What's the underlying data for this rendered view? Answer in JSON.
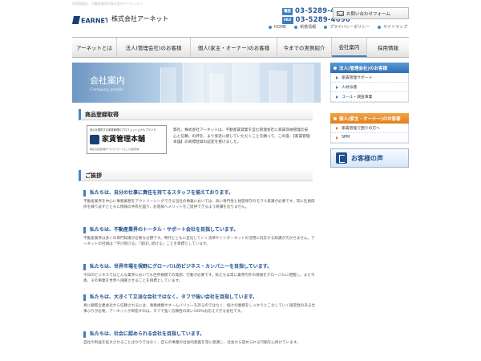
{
  "header": {
    "tagline": "家賃管理は、不動産業界の株式会社アーネットへ",
    "logo_text": "EARNET",
    "company_name": "株式会社アーネット",
    "phone_badge": "電話",
    "phone": "03-5289-4681",
    "fax_badge": "FAX",
    "fax": "03-5289-4690",
    "inquiry_label": "お問い合わせフォーム",
    "utility_nav": [
      "HOME",
      "新着情報",
      "プライバシーポリシー",
      "サイトマップ"
    ]
  },
  "global_nav": {
    "tabs": [
      {
        "label": "アーネットとは"
      },
      {
        "label": "法人(管理会社)のお客様"
      },
      {
        "label": "個人(家主・オーナー)のお客様"
      },
      {
        "label": "今までの実例紹介"
      },
      {
        "label": "会社案内"
      },
      {
        "label": "採用情報"
      }
    ],
    "active_index": 4
  },
  "hero": {
    "title": "会社案内",
    "subtitle": "Company profile"
  },
  "trademark_section": {
    "heading": "商品登録取得",
    "badge_caption": "安心を提供する家賃管理のプロフェッショナルブランド",
    "badge_name": "家賃管理本舗",
    "badge_footer": "弊社の家賃管理サービスブランドとして商標登録",
    "text": "弊社、株式会社アーネットは、不動産賃貸業を営む管理会社に家賃収納管理の安心と信頼、の評を、より身近に感じていただくことを願って、この度、【家賃管理本舗】の商標登録の認定を受けました。"
  },
  "greeting_section": {
    "heading": "ご挨拶",
    "blocks": [
      {
        "heading": "私たちは、自分の仕事に責任を持てるスタッフを揃えております。",
        "body": "不動産業界を中心に事務業務をアウトソーシングできる当社の事業においては、高い専門性と秘密保守のモラル意識が必要です。常に社員研修を繰り返すとともに情報の共有を図り、お客様へメリットをご提供できるよう研鑽を怠りません。"
      },
      {
        "heading": "私たちは、不動産業界のトータル・サポート会社を目指しています。",
        "body": "不動産業界は多くの専門知識が必要な分野です。時代とともに変化していく法律やインターネットの活用に対応する知識が欠かせません。アーネットの社員は「学び続ける」「進化し続ける」ことを目標としています。"
      },
      {
        "heading": "私たちは、世界市場を視野にグローバル的ビジネス・カンパニーを目指しています。",
        "body": "今日のビジネスではどんな業界においても世界規模での発想、行動が必要です。私たちは常に業界内外の情報をグローバルに把握し、また今後、その事業を世界へ飛躍させることを目標としています。"
      },
      {
        "heading": "私たちは、大きくて立派な会社ではなく、タフで強い会社を目指しています。",
        "body": "真に顧客企業会社から信頼されるには、事業規模やネームバリューを誇るのではなく、個々の業務をしっかりとこなしていく確実性のある仕事ぶりが必要。アーネットが目指すのは、タフで強く信頼性の高い100%お応えできる会社です。"
      },
      {
        "heading": "私たちは、社会に認められる会社を目指しています。",
        "body": "自社の利益を拡大させることばかりではなく、自らの事業の社会的意義を常に意識し、社会から認められる行動を心掛けています。"
      }
    ]
  },
  "sidebar": {
    "corporate_head": "法人(管理会社)のお客様",
    "corporate_items": [
      "家賃管理サポート",
      "人材派遣",
      "コール・調査事業"
    ],
    "individual_head": "個人(家主・オーナー)のお客様",
    "individual_items": [
      "家賃管理で困りの方へ",
      "SPM"
    ],
    "voice_banner": "お客様の声"
  }
}
